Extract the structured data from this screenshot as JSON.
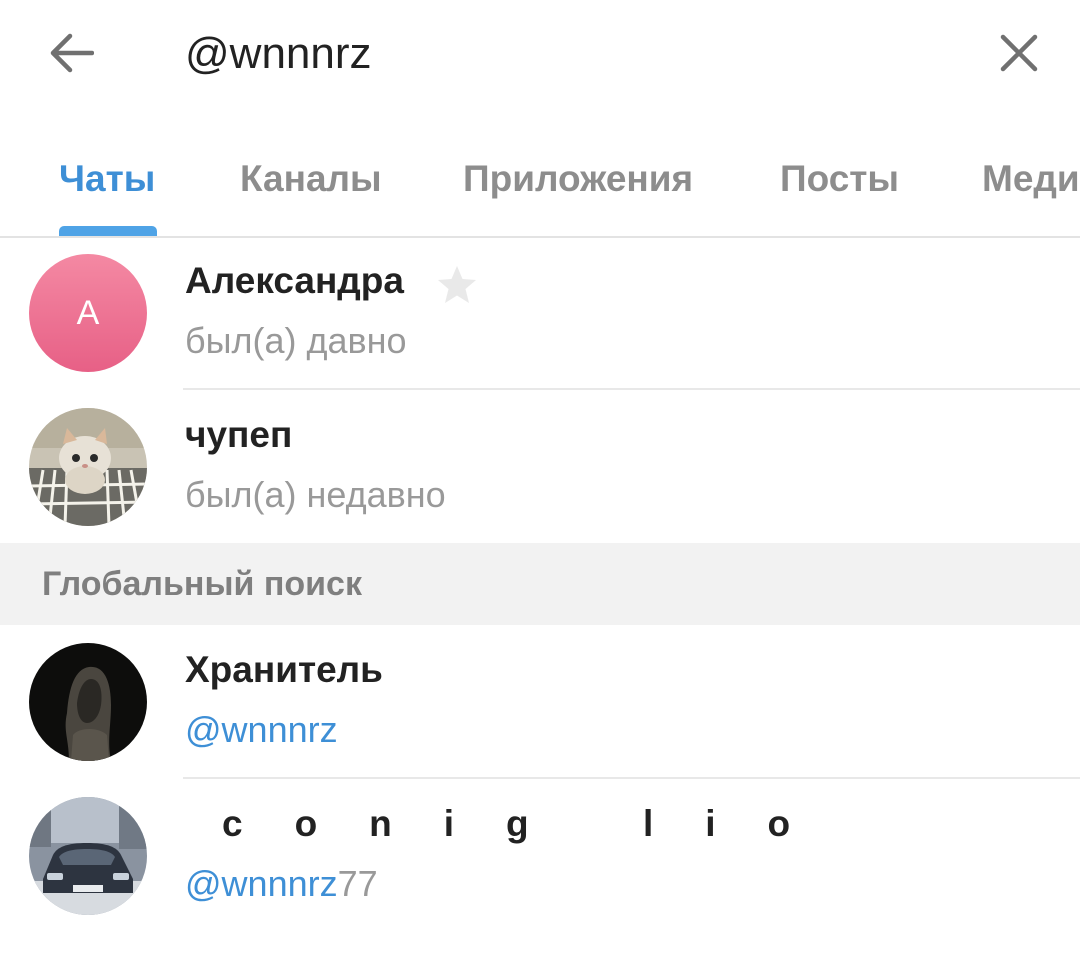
{
  "search": {
    "query": "@wnnnrz"
  },
  "tabs": [
    {
      "label": "Чаты",
      "active": true
    },
    {
      "label": "Каналы",
      "active": false
    },
    {
      "label": "Приложения",
      "active": false
    },
    {
      "label": "Посты",
      "active": false
    },
    {
      "label": "Медиа",
      "active": false
    }
  ],
  "chats": [
    {
      "name": "Александра",
      "status": "был(а) давно",
      "avatar_letter": "A",
      "starred": true
    },
    {
      "name": "чупеп",
      "status": "был(а) недавно"
    }
  ],
  "global_search": {
    "label": "Глобальный поиск",
    "results": [
      {
        "name": "Хранитель",
        "handle_match": "@wnnnrz",
        "handle_rest": ""
      },
      {
        "name": "conig lio",
        "handle_match": "@wnnnrz",
        "handle_rest": "77"
      }
    ]
  },
  "colors": {
    "accent": "#3e8fd6",
    "indicator": "#4fa3e6",
    "muted": "#999999"
  }
}
